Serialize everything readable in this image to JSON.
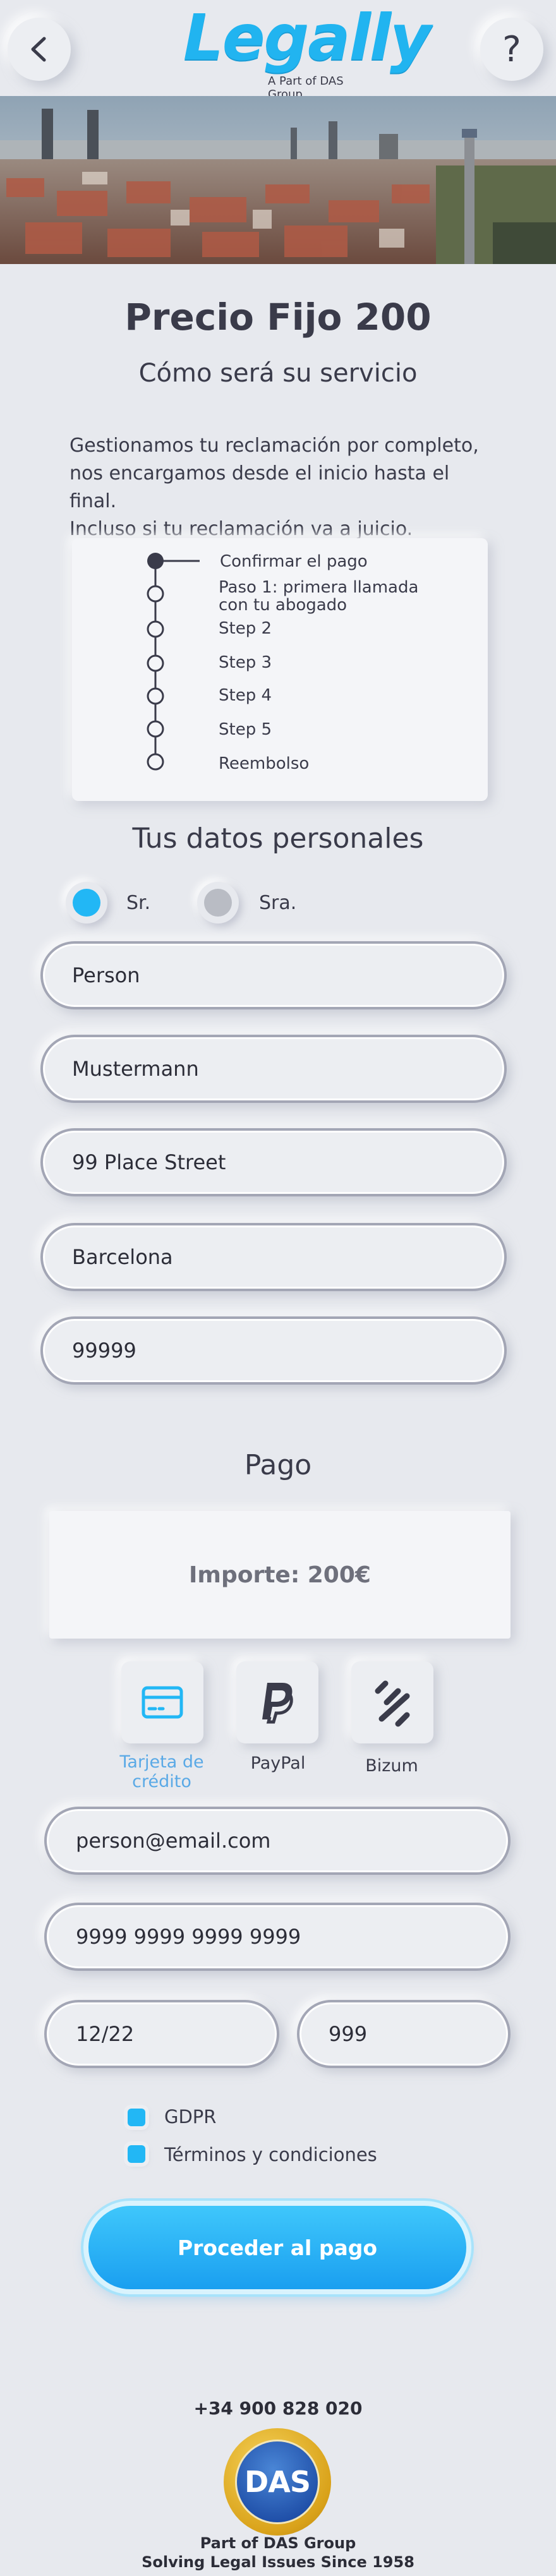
{
  "header": {
    "back_label": "<",
    "help_label": "?",
    "logo_text": "Legally",
    "logo_subtitle": "A Part of DAS Group"
  },
  "service": {
    "title": "Precio Fijo 200",
    "subtitle": "Cómo será su servicio",
    "description_lines": [
      "Gestionamos tu reclamación por completo,",
      "nos encargamos desde el inicio hasta el final.",
      "Incluso si tu reclamación va a juicio."
    ],
    "steps": [
      "Confirmar el pago",
      "Paso 1: primera llamada con tu abogado",
      "Step 2",
      "Step 3",
      "Step 4",
      "Step 5",
      "Reembolso"
    ],
    "step_1_line_a": "Paso 1: primera llamada",
    "step_1_line_b": "con tu abogado"
  },
  "personal": {
    "heading": "Tus datos personales",
    "salutation_options": [
      "Sr.",
      "Sra."
    ],
    "salutation_selected": "Sr.",
    "first_name": "Person",
    "last_name": "Mustermann",
    "street": "99 Place Street",
    "city": "Barcelona",
    "postal_code": "99999"
  },
  "payment": {
    "heading": "Pago",
    "amount_text": "Importe: 200€",
    "methods": [
      {
        "label": "Tarjeta de crédito",
        "icon": "credit-card-icon",
        "selected": true
      },
      {
        "label": "PayPal",
        "icon": "paypal-icon",
        "selected": false
      },
      {
        "label": "Bizum",
        "icon": "bizum-icon",
        "selected": false
      }
    ],
    "email": "person@email.com",
    "card_number": "9999 9999 9999 9999",
    "expiry": "12/22",
    "cvv": "999",
    "checkboxes": [
      "GDPR",
      "Términos y condiciones"
    ],
    "cta_label": "Proceder al pago"
  },
  "footer": {
    "phone": "+34 900 828 020",
    "badge_text": "DAS",
    "line1": "Part of DAS Group",
    "line2": "Solving Legal Issues Since 1958"
  },
  "colors": {
    "accent": "#22b7f5",
    "text": "#3a3b4a",
    "background": "#e7e9ee",
    "selected_label": "#5aa9e6"
  }
}
